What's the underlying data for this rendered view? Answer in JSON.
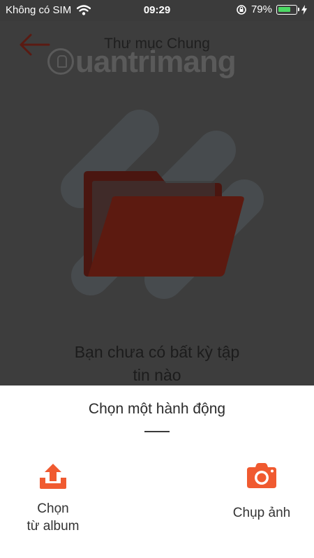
{
  "status_bar": {
    "carrier": "Không có SIM",
    "time": "09:29",
    "battery": "79%",
    "battery_level": 0.79,
    "icons": [
      "wifi-icon",
      "orientation-lock-icon",
      "battery-icon",
      "charging-icon"
    ]
  },
  "header": {
    "title": "Thư mục Chung",
    "back_icon": "back-arrow-icon",
    "watermark": "uantrimang"
  },
  "empty_state": {
    "line1": "Bạn chưa có bất kỳ tập",
    "line2": "tin nào",
    "icon": "folder-icon"
  },
  "sheet": {
    "title": "Chọn một hành động",
    "options": [
      {
        "label_line1": "Chọn",
        "label_line2": "từ album",
        "icon": "upload-icon"
      },
      {
        "label": "Chụp ảnh",
        "icon": "camera-icon"
      }
    ]
  },
  "colors": {
    "accent": "#f05a30",
    "overlay": "#3d3d3d",
    "folder": "#5a1a10",
    "battery": "#4cd964"
  }
}
